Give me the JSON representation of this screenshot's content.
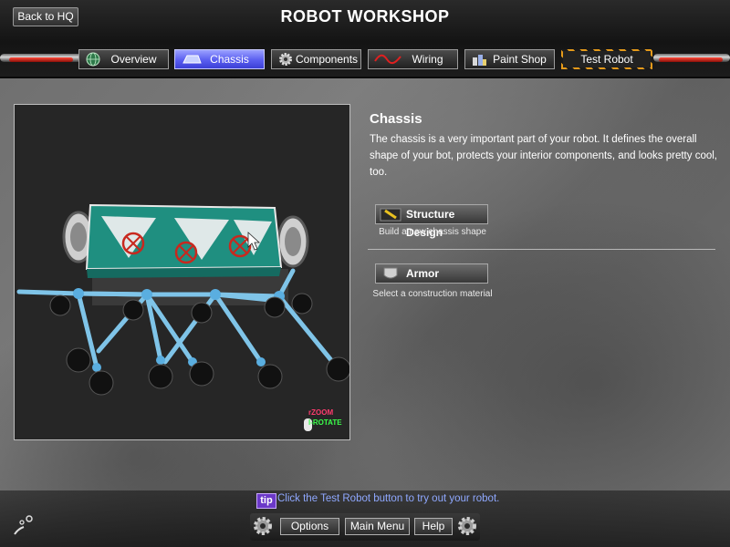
{
  "header": {
    "back_label": "Back to HQ",
    "title": "ROBOT WORKSHOP"
  },
  "tabs": [
    {
      "label": "Overview",
      "icon": "globe-icon"
    },
    {
      "label": "Chassis",
      "icon": "chassis-icon",
      "active": true
    },
    {
      "label": "Components",
      "icon": "gear-icon"
    },
    {
      "label": "Wiring",
      "icon": "wire-icon"
    },
    {
      "label": "Paint Shop",
      "icon": "paint-cans-icon"
    },
    {
      "label": "Test Robot",
      "icon": ""
    }
  ],
  "viewport": {
    "zoom_hint": "ZOOM",
    "rotate_hint": "ROTATE"
  },
  "info": {
    "title": "Chassis",
    "description": "The chassis is a very important part of your robot. It defines the overall shape of your bot, protects your interior components, and looks pretty cool, too.",
    "options": [
      {
        "label": "Structure Design",
        "subtitle": "Build a new chassis shape",
        "icon": "pencil-icon"
      },
      {
        "label": "Armor",
        "subtitle": "Select a construction material",
        "icon": "armor-plate-icon"
      }
    ]
  },
  "footer": {
    "tip_badge": "tip",
    "tip_text": "Click the Test Robot button to try out your robot.",
    "buttons": [
      "Options",
      "Main Menu",
      "Help"
    ]
  },
  "colors": {
    "active_tab": "#5a5ef0",
    "hazard_stripe": "#e59a1a",
    "robot_body": "#1f8f80",
    "strut": "#7fc4e8",
    "tip_text": "#8fa8ff",
    "zoom_hint": "#ff3b6e",
    "rotate_hint": "#3bff4a"
  }
}
